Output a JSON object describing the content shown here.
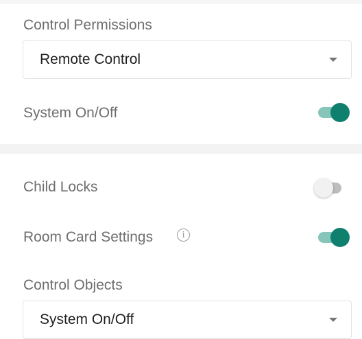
{
  "control_permissions": {
    "label": "Control Permissions",
    "selected_value": "Remote Control"
  },
  "system_on_off": {
    "label": "System On/Off",
    "enabled": true
  },
  "child_locks": {
    "label": "Child Locks",
    "enabled": false
  },
  "room_card_settings": {
    "label": "Room Card Settings",
    "info_glyph": "i",
    "enabled": true
  },
  "control_objects": {
    "label": "Control Objects",
    "selected_value": "System On/Off"
  },
  "icons": {
    "dropdown": "chevron-down-icon",
    "info": "info-icon"
  },
  "colors": {
    "accent": "#0f7f6e",
    "accent_track": "#85c5ba",
    "toggle_off_track": "#bdbdbd"
  }
}
